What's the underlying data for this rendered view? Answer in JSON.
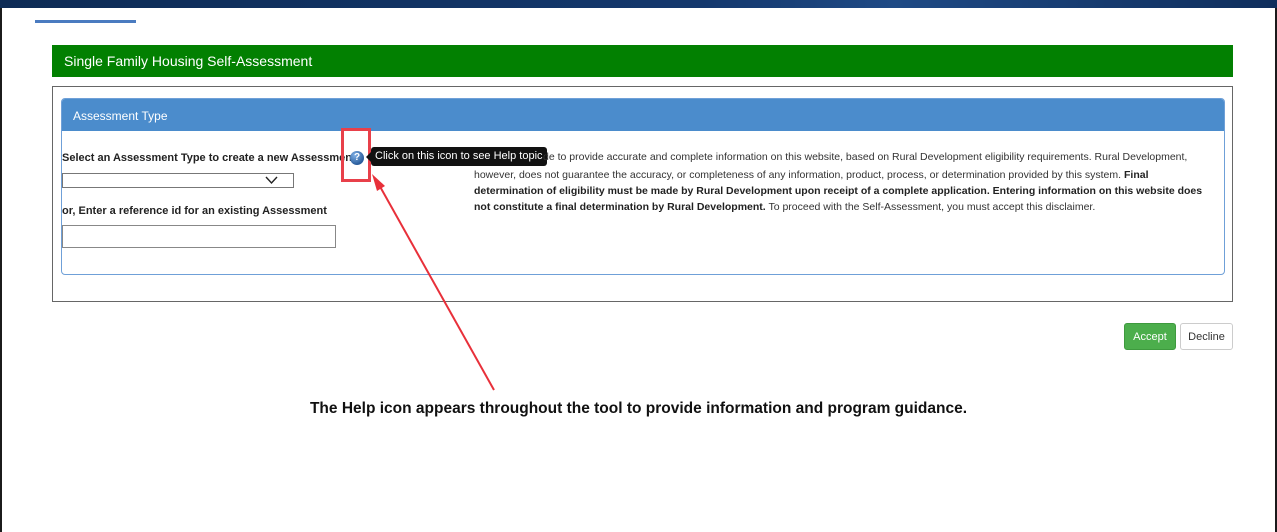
{
  "app": {
    "title": "Single Family Housing Self-Assessment"
  },
  "assessment_panel": {
    "heading": "Assessment Type",
    "select_label": "Select an Assessment Type to create a new Assessmen",
    "select_value": "",
    "reference_label": "or, Enter a reference id for an existing Assessment",
    "reference_value": ""
  },
  "help": {
    "icon": "help-question-icon",
    "tooltip": "Click on this icon to see Help topic"
  },
  "disclaimer": {
    "lead": "de to provide accurate and complete information on this website, based on Rural Development eligibility requirements. Rural Development,",
    "line2": "however, does not guarantee the accuracy, or completeness of any information, product, process, or determination provided by this system.",
    "bold1": "Final determination of eligibility must be made by Rural Development upon receipt of a complete application. Entering information on this website does not constitute a final determination by Rural Development.",
    "tail": "To proceed with the Self-Assessment, you must accept this disclaimer."
  },
  "buttons": {
    "accept": "Accept",
    "decline": "Decline"
  },
  "annotation": {
    "text": "The Help icon appears throughout the tool to provide information and program guidance."
  },
  "colors": {
    "header_green": "#028001",
    "panel_blue": "#4b8ccc",
    "accept_green": "#4cae4c",
    "highlight_red": "#e8404a"
  }
}
